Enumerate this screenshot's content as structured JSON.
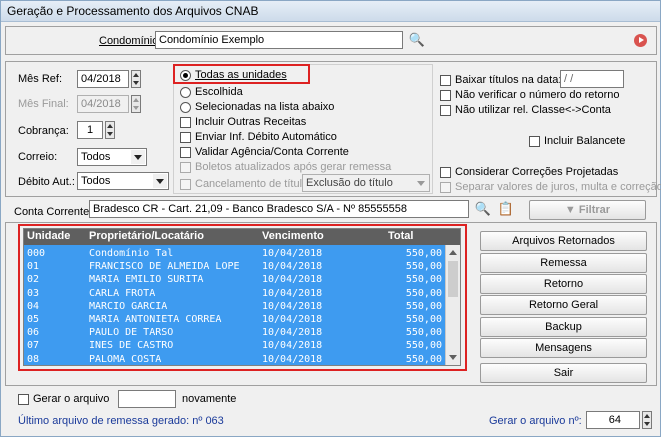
{
  "window": {
    "title": "Geração e Processamento dos Arquivos CNAB"
  },
  "condominio": {
    "label": "Condomínio:",
    "value": "Condomínio Exemplo"
  },
  "left_form": {
    "mes_ref_label": "Mês Ref:",
    "mes_ref_value": "04/2018",
    "mes_final_label": "Mês Final:",
    "mes_final_value": "04/2018",
    "cobranca_label": "Cobrança:",
    "cobranca_value": "1",
    "correio_label": "Correio:",
    "correio_value": "Todos",
    "debito_label": "Débito Aut.:",
    "debito_value": "Todos"
  },
  "options": {
    "todas": "Todas as unidades",
    "escolhida": "Escolhida",
    "selecionadas": "Selecionadas na lista abaixo",
    "incluir_outras": "Incluir Outras Receitas",
    "enviar_debito": "Enviar Inf. Débito Automático",
    "validar_agencia": "Validar Agência/Conta Corrente",
    "boletos_atualizados": "Boletos atualizados após gerar remessa",
    "cancelamento": "Cancelamento de título",
    "cancelamento_value": "Exclusão do título"
  },
  "right_options": {
    "baixar_titulos": "Baixar títulos na data:",
    "baixar_data": " / /",
    "nao_verificar": "Não verificar o número do retorno",
    "nao_utilizar": "Não utilizar rel. Classe<->Conta",
    "incluir_balancete": "Incluir Balancete",
    "considerar": "Considerar Correções Projetadas",
    "separar": "Separar valores de juros, multa e correção"
  },
  "conta": {
    "label": "Conta Corrente:",
    "value": "Bradesco CR - Cart. 21,09 - Banco Bradesco S/A - Nº 85555558",
    "filtrar": "Filtrar"
  },
  "grid": {
    "headers": [
      "Unidade",
      "Proprietário/Locatário",
      "Vencimento",
      "Total"
    ],
    "rows": [
      [
        "000",
        "Condomínio Tal",
        "10/04/2018",
        "550,00"
      ],
      [
        "01",
        "FRANCISCO DE ALMEIDA LOPE",
        "10/04/2018",
        "550,00"
      ],
      [
        "02",
        "MARIA EMILIO SURITA",
        "10/04/2018",
        "550,00"
      ],
      [
        "03",
        "CARLA FROTA",
        "10/04/2018",
        "550,00"
      ],
      [
        "04",
        "MARCIO GARCIA",
        "10/04/2018",
        "550,00"
      ],
      [
        "05",
        "MARIA ANTONIETA CORREA",
        "10/04/2018",
        "550,00"
      ],
      [
        "06",
        "PAULO DE TARSO",
        "10/04/2018",
        "550,00"
      ],
      [
        "07",
        "INES DE CASTRO",
        "10/04/2018",
        "550,00"
      ],
      [
        "08",
        "PALOMA COSTA",
        "10/04/2018",
        "550,00"
      ]
    ]
  },
  "buttons": {
    "arquivos_retornados": "Arquivos Retornados",
    "remessa": "Remessa",
    "retorno": "Retorno",
    "retorno_geral": "Retorno Geral",
    "backup": "Backup",
    "mensagens": "Mensagens",
    "sair": "Sair"
  },
  "footer": {
    "gerar_arquivo": "Gerar o arquivo",
    "novamente": "novamente",
    "ultimo": "Último arquivo de remessa gerado: nº 063",
    "gerar_num_label": "Gerar o arquivo nº:",
    "gerar_num_value": "64"
  }
}
